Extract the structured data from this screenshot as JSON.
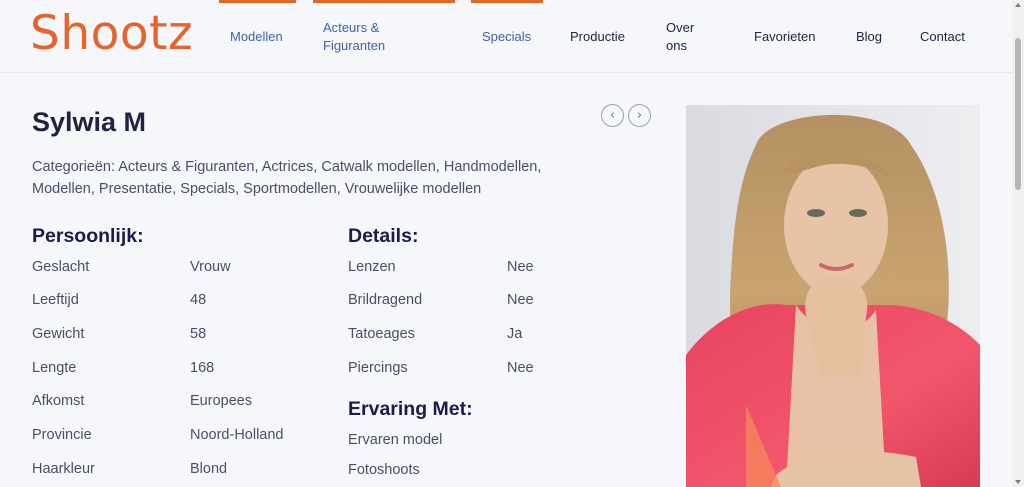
{
  "header": {
    "logo": "Shootz",
    "nav": [
      {
        "label": "Modellen",
        "active": true
      },
      {
        "label": "Acteurs &",
        "label2": "Figuranten",
        "active": true
      },
      {
        "label": "Specials",
        "active": true
      },
      {
        "label": "Productie",
        "active": false
      },
      {
        "label": "Over",
        "label2": "ons",
        "active": false
      },
      {
        "label": "Favorieten",
        "active": false
      },
      {
        "label": "Blog",
        "active": false
      },
      {
        "label": "Contact",
        "active": false
      }
    ]
  },
  "profile": {
    "name": "Sylwia M",
    "prev_icon": "chevron-left-icon",
    "next_icon": "chevron-right-icon",
    "categories_line1": "Categorieën: Acteurs & Figuranten, Actrices, Catwalk modellen, Handmodellen,",
    "categories_line2": "Modellen, Presentatie, Specials, Sportmodellen, Vrouwelijke modellen"
  },
  "personal": {
    "title": "Persoonlijk:",
    "rows": [
      {
        "label": "Geslacht",
        "value": "Vrouw"
      },
      {
        "label": "Leeftijd",
        "value": "48"
      },
      {
        "label": "Gewicht",
        "value": "58"
      },
      {
        "label": "Lengte",
        "value": "168"
      },
      {
        "label": "Afkomst",
        "value": "Europees"
      },
      {
        "label": "Provincie",
        "value": "Noord-Holland"
      },
      {
        "label": "Haarkleur",
        "value": "Blond"
      }
    ]
  },
  "details": {
    "title": "Details:",
    "rows": [
      {
        "label": "Lenzen",
        "value": "Nee"
      },
      {
        "label": "Brildragend",
        "value": "Nee"
      },
      {
        "label": "Tatoeages",
        "value": "Ja"
      },
      {
        "label": "Piercings",
        "value": "Nee"
      }
    ]
  },
  "experience": {
    "title": "Ervaring Met:",
    "items": [
      "Ervaren model",
      "Fotoshoots"
    ]
  },
  "colors": {
    "brand": "#e8622c",
    "accent_nav": "#3f63a6",
    "heading": "#1a1c4a",
    "text": "#4b4f63",
    "background": "#f6f7fb"
  }
}
